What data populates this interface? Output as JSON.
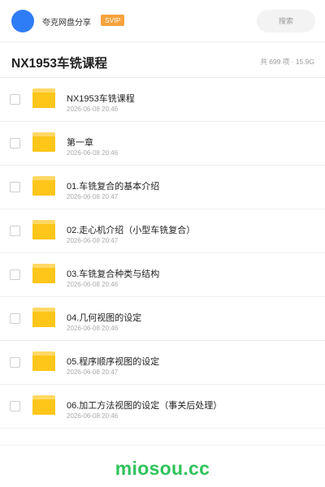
{
  "header": {
    "app_name": "夸克网盘分享",
    "badge": "SVIP",
    "search_placeholder": "搜索",
    "accent_color": "#2f7df6",
    "badge_color": "#f6a23c"
  },
  "title_bar": {
    "title": "NX1953车铣课程",
    "summary": "共 699 项 · 15.9G"
  },
  "files": [
    {
      "name": "NX1953车铣课程",
      "date": "2026-06-08 20:46",
      "icon": "folder-icon"
    },
    {
      "name": "第一章",
      "date": "2026-06-08 20:46",
      "icon": "folder-icon"
    },
    {
      "name": "01.车铣复合的基本介绍",
      "date": "2026-06-08 20:47",
      "icon": "folder-icon"
    },
    {
      "name": "02.走心机介绍（小型车铣复合）",
      "date": "2026-06-08 20:47",
      "icon": "folder-icon"
    },
    {
      "name": "03.车铣复合种类与结构",
      "date": "2026-06-08 20:46",
      "icon": "folder-icon"
    },
    {
      "name": "04.几何视图的设定",
      "date": "2026-06-08 20:46",
      "icon": "folder-icon"
    },
    {
      "name": "05.程序顺序视图的设定",
      "date": "2026-06-08 20:47",
      "icon": "folder-icon"
    },
    {
      "name": "06.加工方法视图的设定（事关后处理）",
      "date": "2026-06-08 20:46",
      "icon": "folder-icon"
    }
  ],
  "footer": {
    "watermark": "miosou.cc",
    "watermark_color": "#2ec35a"
  }
}
